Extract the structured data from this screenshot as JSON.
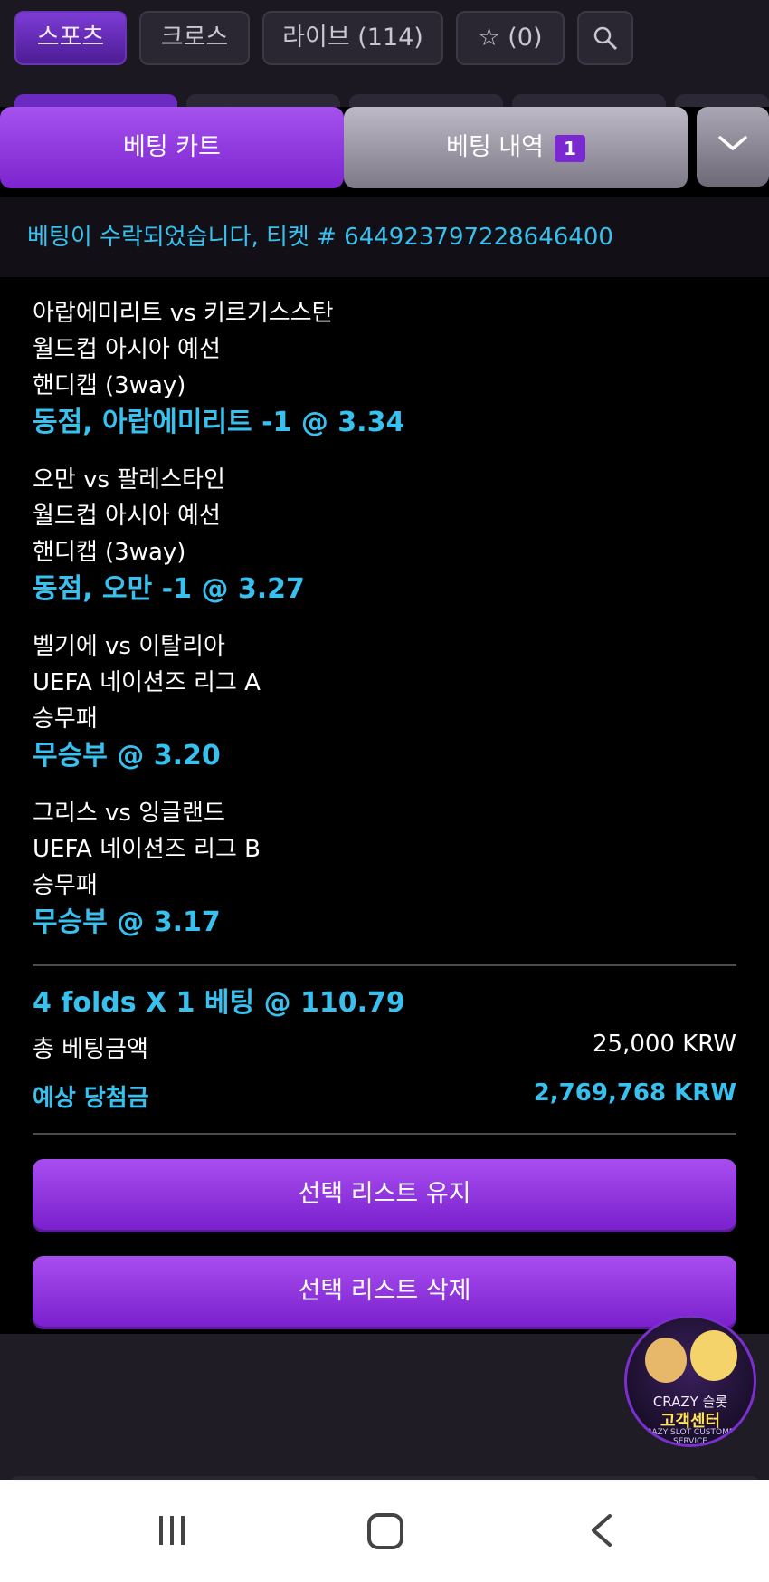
{
  "top_nav": {
    "tabs": [
      {
        "label": "스포츠",
        "active": true
      },
      {
        "label": "크로스",
        "active": false
      },
      {
        "label": "라이브 (114)",
        "active": false
      },
      {
        "label": "☆ (0)",
        "active": false
      }
    ],
    "search_icon": "search-icon"
  },
  "bet_panel": {
    "cart_tab": "베팅 카트",
    "history_tab": "베팅 내역",
    "history_count": "1",
    "collapse_icon": "chevron-down-icon",
    "accepted_message": "베팅이 수락되었습니다, 티켓 # 644923797228646400",
    "selections": [
      {
        "match": "아랍에미리트 vs 키르기스스탄",
        "league": "월드컵 아시아 예선",
        "market": "핸디캡 (3way)",
        "pick": "동점, 아랍에미리트 -1 @ 3.34"
      },
      {
        "match": "오만 vs 팔레스타인",
        "league": "월드컵 아시아 예선",
        "market": "핸디캡 (3way)",
        "pick": "동점, 오만 -1 @ 3.27"
      },
      {
        "match": "벨기에 vs 이탈리아",
        "league": "UEFA 네이션즈 리그 A",
        "market": "승무패",
        "pick": "무승부 @ 3.20"
      },
      {
        "match": "그리스 vs 잉글랜드",
        "league": "UEFA 네이션즈 리그 B",
        "market": "승무패",
        "pick": "무승부 @ 3.17"
      }
    ],
    "summary": {
      "folds": "4 folds X 1 베팅 @ 110.79",
      "total_label": "총 베팅금액",
      "total_value": "25,000 KRW",
      "payout_label": "예상 당첨금",
      "payout_value": "2,769,768 KRW"
    },
    "buttons": {
      "keep": "선택 리스트 유지",
      "delete": "선택 리스트 삭제"
    }
  },
  "support_widget": {
    "brand": "CRAZY 슬롯",
    "label": "고객센터",
    "tiny": "CRAZY SLOT CUSTOMER SERVICE"
  },
  "colors": {
    "accent_purple": "#8a2be2",
    "pick_blue": "#38c0ee"
  }
}
